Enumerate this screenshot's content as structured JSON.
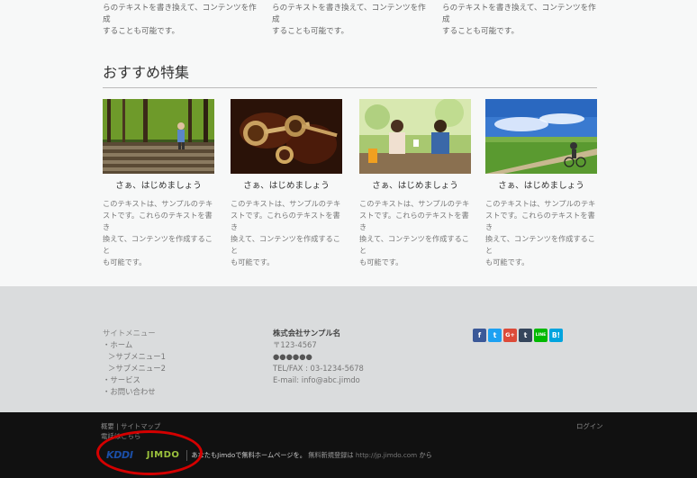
{
  "top_texts": [
    [
      "らのテキストを書き換えて、コンテンツを作成",
      "することも可能です。"
    ],
    [
      "らのテキストを書き換えて、コンテンツを作成",
      "することも可能です。"
    ],
    [
      "らのテキストを書き換えて、コンテンツを作成",
      "することも可能です。"
    ]
  ],
  "section_title": "おすすめ特集",
  "cards": [
    {
      "title": "さぁ、はじめましょう",
      "lines": [
        "このテキストは、サンプルのテキ",
        "ストです。これらのテキストを書き",
        "換えて、コンテンツを作成すること",
        "も可能です。"
      ]
    },
    {
      "title": "さぁ、はじめましょう",
      "lines": [
        "このテキストは、サンプルのテキ",
        "ストです。これらのテキストを書き",
        "換えて、コンテンツを作成すること",
        "も可能です。"
      ]
    },
    {
      "title": "さぁ、はじめましょう",
      "lines": [
        "このテキストは、サンプルのテキ",
        "ストです。これらのテキストを書き",
        "換えて、コンテンツを作成すること",
        "も可能です。"
      ]
    },
    {
      "title": "さぁ、はじめましょう",
      "lines": [
        "このテキストは、サンプルのテキ",
        "ストです。これらのテキストを書き",
        "換えて、コンテンツを作成すること",
        "も可能です。"
      ]
    }
  ],
  "site_menu": {
    "heading": "サイトメニュー",
    "items": [
      "・ホーム",
      "＞サブメニュー1",
      "＞サブメニュー2",
      "・サービス",
      "・お問い合わせ"
    ]
  },
  "company": {
    "name": "株式会社サンプル名",
    "zip": "〒123-4567",
    "address": "●●●●●●",
    "tel": "TEL/FAX : 03-1234-5678",
    "email": "E-mail: info@abc.jimdo"
  },
  "social": [
    {
      "label": "f",
      "color": "#3b5998",
      "icon": "facebook-icon"
    },
    {
      "label": "t",
      "color": "#1da1f2",
      "icon": "twitter-icon"
    },
    {
      "label": "G+",
      "color": "#dd4b39",
      "icon": "google-plus-icon"
    },
    {
      "label": "t",
      "color": "#35465c",
      "icon": "tumblr-icon"
    },
    {
      "label": "LINE",
      "color": "#00b900",
      "icon": "line-icon"
    },
    {
      "label": "B!",
      "color": "#00a4de",
      "icon": "hatena-bookmark-icon"
    }
  ],
  "footer": {
    "links": "概要 | サイトマップ",
    "links2": "電話はこちら",
    "login": "ログイン",
    "kddi": "KDDI",
    "jimdo": "JIMDO",
    "promo_main": "あなたもJimdoで無料ホームページを。",
    "promo_mid": "無料新規登録は",
    "promo_url": "http://jp.jimdo.com",
    "promo_end": "から"
  }
}
